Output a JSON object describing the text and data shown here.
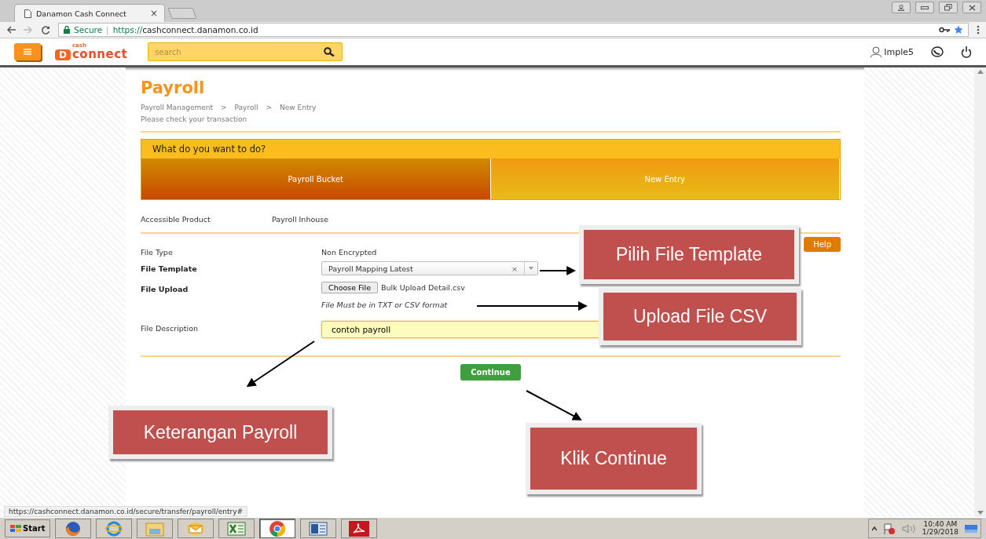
{
  "browser": {
    "tab": {
      "title": "Danamon Cash Connect",
      "close": "×"
    },
    "address": {
      "secure_label": "Secure",
      "separator": "|",
      "scheme": "https://",
      "host": "cashconnect.danamon.co.id"
    }
  },
  "app_header": {
    "logo": {
      "letter": "D",
      "small": "cash",
      "word": "connect"
    },
    "search": {
      "placeholder": "search"
    },
    "user": "Imple5"
  },
  "page": {
    "title": "Payroll",
    "breadcrumb": [
      "Payroll Management",
      "Payroll",
      "New Entry"
    ],
    "breadcrumb_separator": ">",
    "subtitle": "Please check your transaction",
    "action_panel": {
      "heading": "What do you want to do?",
      "tabs": [
        {
          "label": "Payroll Bucket",
          "selected": false
        },
        {
          "label": "New Entry",
          "selected": true
        }
      ]
    },
    "accessible_product": {
      "label": "Accessible Product",
      "value": "Payroll Inhouse"
    },
    "help_button": "Help",
    "form": [
      {
        "kind": "text",
        "label": "File Type",
        "bold": false,
        "value": "Non Encrypted"
      },
      {
        "kind": "select",
        "label": "File Template",
        "bold": true,
        "value": "Payroll Mapping Latest",
        "clear": "×"
      },
      {
        "kind": "file",
        "label": "File Upload",
        "bold": true,
        "button": "Choose File",
        "value": "Bulk Upload Detail.csv",
        "hint": "File Must be in TXT or CSV format"
      },
      {
        "kind": "input",
        "label": "File Description",
        "bold": false,
        "value": "contoh payroll"
      }
    ],
    "continue_button": "Continue"
  },
  "annotations": [
    {
      "text": "Pilih File Template"
    },
    {
      "text": "Upload File CSV"
    },
    {
      "text": "Keterangan Payroll"
    },
    {
      "text": "Klik Continue"
    }
  ],
  "status_url": "https://cashconnect.danamon.co.id/secure/transfer/payroll/entry#",
  "taskbar": {
    "start": "Start",
    "apps": [
      {
        "kind": "firefox",
        "selected": false
      },
      {
        "kind": "ie",
        "selected": false
      },
      {
        "kind": "folder",
        "selected": false
      },
      {
        "kind": "mail",
        "selected": false
      },
      {
        "kind": "excel",
        "selected": false
      },
      {
        "kind": "chrome",
        "selected": true
      },
      {
        "kind": "word",
        "selected": false
      },
      {
        "kind": "pdf",
        "selected": false
      }
    ],
    "time": "10:40 AM",
    "date": "1/29/2018"
  }
}
